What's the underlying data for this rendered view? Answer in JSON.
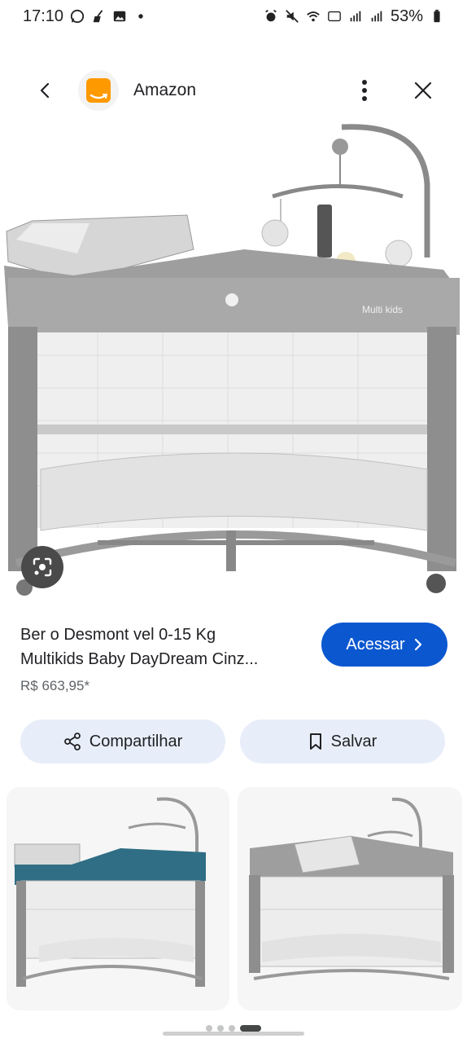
{
  "status_bar": {
    "time": "17:10",
    "battery": "53%",
    "left_icons": [
      "whatsapp-icon",
      "broom-icon",
      "image-icon",
      "dot-icon"
    ],
    "right_icons": [
      "alarm-icon",
      "mute-icon",
      "wifi-icon",
      "volte-icon",
      "signal-icon",
      "signal-icon",
      "battery-icon"
    ]
  },
  "header": {
    "site_name": "Amazon",
    "back_icon": "chevron-left-icon",
    "more_icon": "more-vert-icon",
    "close_icon": "close-icon"
  },
  "product": {
    "title_line1": "Ber o Desmont vel 0-15 Kg",
    "title_line2": "Multikids Baby DayDream Cinz...",
    "price": "R$ 663,95*",
    "visit_label": "Acessar",
    "share_label": "Compartilhar",
    "save_label": "Salvar"
  },
  "hero_image": {
    "brand_mark": "Multi kids",
    "lens_icon": "lens-search-icon"
  },
  "pager": {
    "count": 4,
    "active_index": 3
  },
  "colors": {
    "accent": "#0b57d0",
    "chip_bg": "#e8eef9",
    "amazon_orange": "#ff9900"
  }
}
